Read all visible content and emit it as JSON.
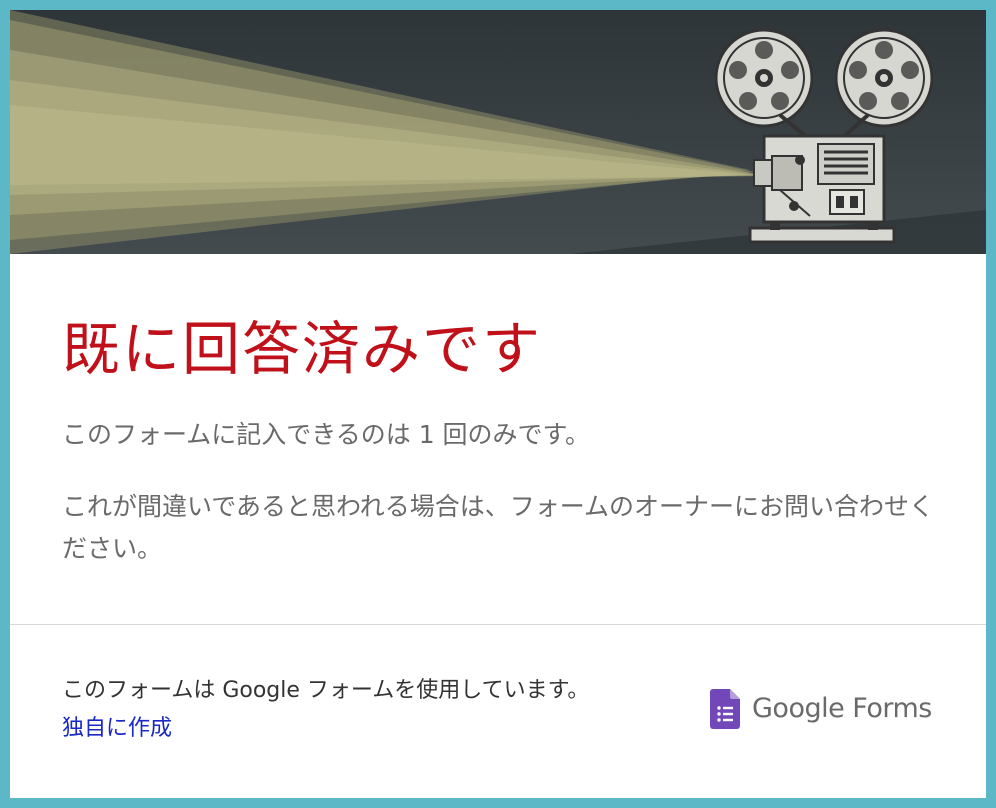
{
  "title": "既に回答済みです",
  "message_1": "このフォームに記入できるのは 1 回のみです。",
  "message_2": "これが間違いであると思われる場合は、フォームのオーナーにお問い合わせください。",
  "footer": {
    "note": "このフォームは Google フォームを使用しています。",
    "create_link": "独自に作成",
    "logo_text": "Google Forms"
  },
  "colors": {
    "accent_border": "#5cb8c6",
    "title_red": "#c0111a",
    "link_blue": "#1a28c8",
    "forms_purple": "#7248b9"
  },
  "icons": [
    "film-projector-illustration",
    "google-forms-icon"
  ]
}
